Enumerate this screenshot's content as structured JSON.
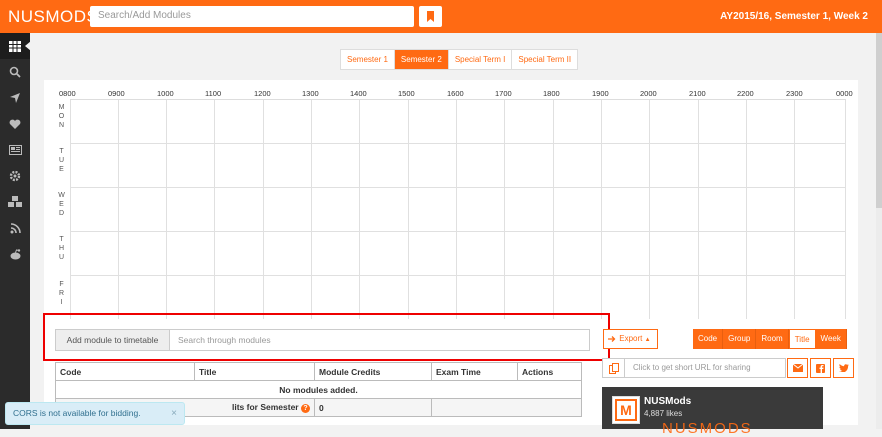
{
  "app": {
    "logo": "NUSMODS",
    "search_placeholder": "Search/Add Modules",
    "academic_year": "AY2015/16, Semester 1, Week 2",
    "brand_color": "#ff6a13"
  },
  "sidebar": {
    "items": [
      {
        "icon": "timetable-grid-icon",
        "active": true
      },
      {
        "icon": "search-icon"
      },
      {
        "icon": "navigation-arrow-icon"
      },
      {
        "icon": "heart-icon"
      },
      {
        "icon": "newspaper-icon"
      },
      {
        "icon": "gear-icon"
      },
      {
        "icon": "cubes-icon"
      },
      {
        "icon": "rss-icon"
      },
      {
        "icon": "reddit-icon"
      }
    ]
  },
  "semester_tabs": [
    {
      "label": "Semester 1",
      "active": false
    },
    {
      "label": "Semester 2",
      "active": true
    },
    {
      "label": "Special Term I",
      "active": false
    },
    {
      "label": "Special Term II",
      "active": false
    }
  ],
  "timetable": {
    "hours": [
      "0800",
      "0900",
      "1000",
      "1100",
      "1200",
      "1300",
      "1400",
      "1500",
      "1600",
      "1700",
      "1800",
      "1900",
      "2000",
      "2100",
      "2200",
      "2300",
      "0000"
    ],
    "days": [
      "MON",
      "TUE",
      "WED",
      "THU",
      "FRI"
    ]
  },
  "add_module": {
    "label": "Add module to timetable",
    "placeholder": "Search through modules"
  },
  "export_label": "Export",
  "view_options": [
    {
      "label": "Code",
      "active": false
    },
    {
      "label": "Group",
      "active": false
    },
    {
      "label": "Room",
      "active": false
    },
    {
      "label": "Title",
      "active": true
    },
    {
      "label": "Week",
      "active": false
    }
  ],
  "short_url_placeholder": "Click to get short URL for sharing",
  "share_icons": [
    "email-icon",
    "facebook-icon",
    "twitter-icon"
  ],
  "modules_table": {
    "headers": [
      "Code",
      "Title",
      "Module Credits",
      "Exam Time",
      "Actions"
    ],
    "empty_message": "No modules added.",
    "total_label": "lits for Semester",
    "total_value": "0"
  },
  "facebook": {
    "name": "NUSMods",
    "likes": "4,887 likes",
    "banner_text": "NUSMODS"
  },
  "toast": {
    "message": "CORS is not available for bidding.",
    "close": "×"
  }
}
